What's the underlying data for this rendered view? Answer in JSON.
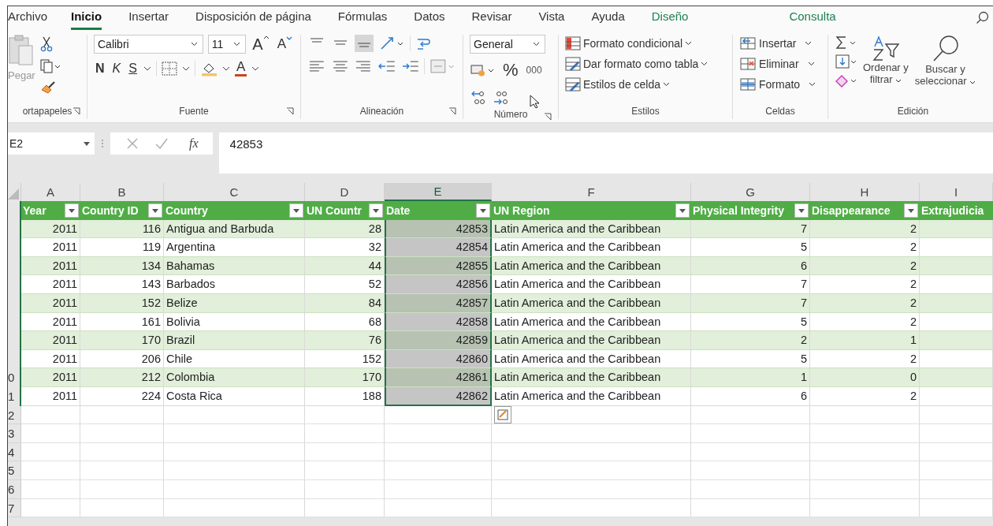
{
  "menu_tabs": [
    {
      "label": "Archivo",
      "selected": false,
      "kind": "plain"
    },
    {
      "label": "Inicio",
      "selected": true,
      "kind": "plain"
    },
    {
      "label": "Insertar",
      "selected": false,
      "kind": "plain"
    },
    {
      "label": "Disposición de página",
      "selected": false,
      "kind": "plain"
    },
    {
      "label": "Fórmulas",
      "selected": false,
      "kind": "plain"
    },
    {
      "label": "Datos",
      "selected": false,
      "kind": "plain"
    },
    {
      "label": "Revisar",
      "selected": false,
      "kind": "plain"
    },
    {
      "label": "Vista",
      "selected": false,
      "kind": "plain"
    },
    {
      "label": "Ayuda",
      "selected": false,
      "kind": "plain"
    },
    {
      "label": "Diseño",
      "selected": false,
      "kind": "contextual"
    },
    {
      "label": "Consulta",
      "selected": false,
      "kind": "contextual"
    }
  ],
  "ribbon": {
    "clipboard": {
      "paste": "Pegar",
      "label": "ortapapeles"
    },
    "font": {
      "name": "Calibri",
      "size": "11",
      "grow": "A",
      "shrink": "A",
      "bold": "N",
      "italic": "K",
      "underline": "S",
      "font_color": "A",
      "label": "Fuente"
    },
    "alignment": {
      "label": "Alineación"
    },
    "number": {
      "format": "General",
      "percent": "%",
      "thousands": "000",
      "label": "Número"
    },
    "styles": {
      "items": [
        "Formato condicional",
        "Dar formato como tabla",
        "Estilos de celda"
      ],
      "label": "Estilos"
    },
    "cells": {
      "items": [
        "Insertar",
        "Eliminar",
        "Formato"
      ],
      "label": "Celdas"
    },
    "editing": {
      "sort": [
        "Ordenar y",
        "filtrar"
      ],
      "find": [
        "Buscar y",
        "seleccionar"
      ],
      "label": "Edición"
    }
  },
  "formula_bar": {
    "name_box": "E2",
    "function_label": "fx",
    "formula": "42853"
  },
  "sheet": {
    "columns": [
      {
        "letter": "A",
        "header": "Year",
        "kind": "number",
        "selected": false
      },
      {
        "letter": "B",
        "header": "Country ID",
        "kind": "number",
        "selected": false
      },
      {
        "letter": "C",
        "header": "Country",
        "kind": "text",
        "selected": false
      },
      {
        "letter": "D",
        "header": "UN Countr",
        "kind": "number",
        "selected": false
      },
      {
        "letter": "E",
        "header": "Date",
        "kind": "number",
        "selected": true
      },
      {
        "letter": "F",
        "header": "UN Region",
        "kind": "text",
        "selected": false
      },
      {
        "letter": "G",
        "header": "Physical Integrity",
        "kind": "number",
        "selected": false
      },
      {
        "letter": "H",
        "header": "Disappearance",
        "kind": "number",
        "selected": false
      },
      {
        "letter": "I",
        "header": "Extrajudicia",
        "kind": "number",
        "selected": false
      }
    ],
    "rows": [
      {
        "cells": [
          "2011",
          "116",
          "Antigua and Barbuda",
          "28",
          "42853",
          "Latin America and the Caribbean",
          "7",
          "2"
        ]
      },
      {
        "cells": [
          "2011",
          "119",
          "Argentina",
          "32",
          "42854",
          "Latin America and the Caribbean",
          "5",
          "2"
        ]
      },
      {
        "cells": [
          "2011",
          "134",
          "Bahamas",
          "44",
          "42855",
          "Latin America and the Caribbean",
          "6",
          "2"
        ]
      },
      {
        "cells": [
          "2011",
          "143",
          "Barbados",
          "52",
          "42856",
          "Latin America and the Caribbean",
          "7",
          "2"
        ]
      },
      {
        "cells": [
          "2011",
          "152",
          "Belize",
          "84",
          "42857",
          "Latin America and the Caribbean",
          "7",
          "2"
        ]
      },
      {
        "cells": [
          "2011",
          "161",
          "Bolivia",
          "68",
          "42858",
          "Latin America and the Caribbean",
          "5",
          "2"
        ]
      },
      {
        "cells": [
          "2011",
          "170",
          "Brazil",
          "76",
          "42859",
          "Latin America and the Caribbean",
          "2",
          "1"
        ]
      },
      {
        "cells": [
          "2011",
          "206",
          "Chile",
          "152",
          "42860",
          "Latin America and the Caribbean",
          "5",
          "2"
        ]
      },
      {
        "row_label": "0",
        "cells": [
          "2011",
          "212",
          "Colombia",
          "170",
          "42861",
          "Latin America and the Caribbean",
          "1",
          "0"
        ]
      },
      {
        "row_label": "1",
        "cells": [
          "2011",
          "224",
          "Costa Rica",
          "188",
          "42862",
          "Latin America and the Caribbean",
          "6",
          "2"
        ]
      }
    ],
    "empty_rows": [
      "2",
      "3",
      "4",
      "5",
      "6",
      "7"
    ]
  }
}
